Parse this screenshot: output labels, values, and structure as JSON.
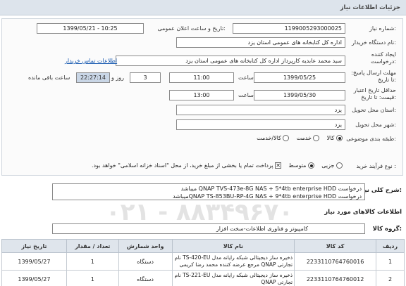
{
  "header": {
    "title": "جزئیات اطلاعات نیاز"
  },
  "fields": {
    "need_number_label": "شماره نیاز:",
    "need_number": "1199005293000025",
    "announce_label": "تاریخ و ساعت اعلان عمومی:",
    "announce_value": "1399/05/21 - 10:25",
    "buyer_label": "نام دستگاه خریدار:",
    "buyer_value": "اداره کل کتابخانه های عمومی استان یزد",
    "creator_label": "ایجاد کننده درخواست:",
    "creator_value": "سید محمد عابدیه کارپرداز اداره کل کتابخانه های عمومی استان یزد",
    "contact_link": "اطلاعات تماس خریدار",
    "reply_deadline_label": "مهلت ارسال پاسخ: تا تاریخ:",
    "reply_date": "1399/05/25",
    "time_label": "ساعت",
    "reply_time": "11:00",
    "days_value": "3",
    "days_label": "روز و",
    "remaining_time": "22:27:14",
    "remaining_label": "ساعت باقی مانده",
    "validity_label": "حداقل تاریخ اعتبار قیمت: تا تاریخ:",
    "validity_date": "1399/05/30",
    "validity_time": "13:00",
    "province_label": "استان محل تحویل:",
    "province_value": "یزد",
    "city_label": "شهر محل تحویل:",
    "city_value": "یزد",
    "category_label": "طبقه بندی موضوعی:",
    "category_options": [
      "کالا",
      "خدمت",
      "کالا/خدمت"
    ],
    "category_selected": "کالا",
    "process_label": "نوع فرآیند خرید :",
    "process_options": [
      "جزیی",
      "متوسط"
    ],
    "process_selected": "متوسط",
    "payment_note": "پرداخت تمام یا بخشی از مبلغ خرید، از محل \"اسناد خزانه اسلامی\" خواهد بود."
  },
  "summary": {
    "title": "شرح کلی نیاز:",
    "line1": "درخواست QNAP TVS-473e-8G NAS + 5*4tb enterprise HDD میباشد",
    "line2": "درخواست QNAP TS-853BU-RP-4G NAS + 9*4tb enterprise HDDمیباشد"
  },
  "items_section": {
    "title": "اطلاعات کالاهای مورد نیاز",
    "group_label": "گروه کالا:",
    "group_value": "کامپیوتر و فناوری اطلاعات-سخت افزار"
  },
  "watermark": "۰۲۱ - ۸۸۳۴۹۶۷۰",
  "table": {
    "headers": [
      "ردیف",
      "کد کالا",
      "نام کالا",
      "واحد شمارش",
      "تعداد / مقدار",
      "تاریخ نیاز"
    ],
    "rows": [
      {
        "row": "1",
        "code": "2233110764760016",
        "name": "ذخیره ساز دیجیتالی شبکه رایانه مدل TS-420-EU نام تجارتی QNAP مرجع عرضه کننده محمد رضا کریمی",
        "unit": "دستگاه",
        "qty": "1",
        "date": "1399/05/27"
      },
      {
        "row": "2",
        "code": "2233110764760012",
        "name": "ذخیره ساز دیجیتالی شبکه رایانه مدل TS-221-EU نام تجارتی QNAP",
        "unit": "دستگاه",
        "qty": "1",
        "date": "1399/05/27"
      }
    ]
  }
}
